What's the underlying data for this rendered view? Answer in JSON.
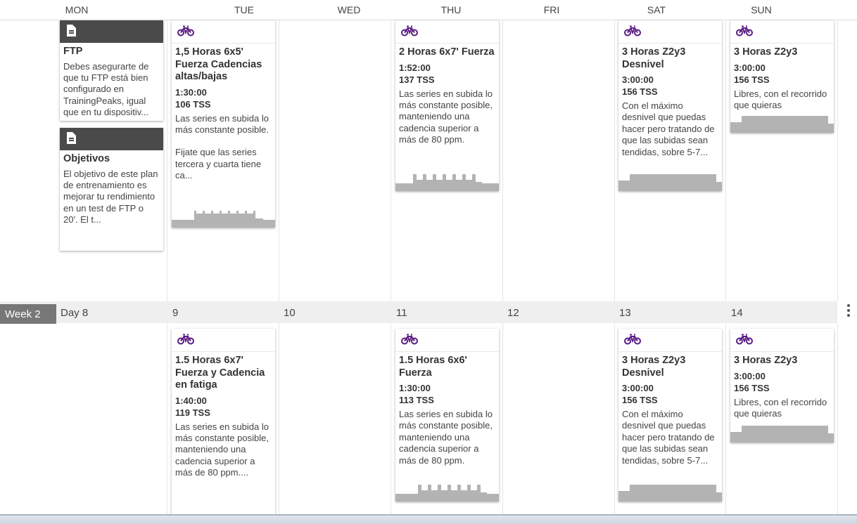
{
  "days": [
    "MON",
    "TUE",
    "WED",
    "THU",
    "FRI",
    "SAT",
    "SUN"
  ],
  "notes": [
    {
      "title": "FTP",
      "text": "Debes asegurarte de que tu FTP está bien configurado en TrainingPeaks, igual que en tu dispositiv..."
    },
    {
      "title": "Objetivos",
      "text": "El objetivo de este plan de entrenamiento es mejorar tu rendimiento en un test de FTP o 20'. El t..."
    }
  ],
  "week1": [
    {
      "title": "1,5 Horas 6x5' Fuerza Cadencias altas/bajas",
      "duration": "1:30:00",
      "tss": "106 TSS",
      "desc1": "Las series en subida lo más constante posible.",
      "desc2": "Fijate que las series tercera y cuarta tiene ca..."
    },
    {
      "title": "2 Horas 6x7' Fuerza",
      "duration": "1:52:00",
      "tss": "137 TSS",
      "desc1": "Las series en subida lo más constante posible, manteniendo una cadencia superior a más de 80 ppm."
    },
    {
      "title": "3 Horas Z2y3 Desnivel",
      "duration": "3:00:00",
      "tss": "156 TSS",
      "desc1": "Con el máximo desnivel que puedas hacer pero tratando de que las subidas sean tendidas, sobre 5-7..."
    },
    {
      "title": "3 Horas Z2y3",
      "duration": "3:00:00",
      "tss": "156 TSS",
      "desc1": "Libres, con el recorrido que quieras"
    }
  ],
  "week2": {
    "label": "Week 2",
    "day_numbers": [
      "Day 8",
      "9",
      "10",
      "11",
      "12",
      "13",
      "14"
    ],
    "workouts": [
      {
        "title": "1.5 Horas 6x7' Fuerza y Cadencia en fatiga",
        "duration": "1:40:00",
        "tss": "119 TSS",
        "desc1": "Las series en subida lo más constante posible, manteniendo una cadencia superior a más de 80 ppm...."
      },
      {
        "title": "1.5 Horas 6x6' Fuerza",
        "duration": "1:30:00",
        "tss": "113 TSS",
        "desc1": "Las series en subida lo más constante posible, manteniendo una cadencia superior a más de 80 ppm."
      },
      {
        "title": "3 Horas Z2y3 Desnivel",
        "duration": "3:00:00",
        "tss": "156 TSS",
        "desc1": "Con el máximo desnivel que puedas hacer pero tratando de que las subidas sean tendidas, sobre 5-7..."
      },
      {
        "title": "3 Horas Z2y3",
        "duration": "3:00:00",
        "tss": "156 TSS",
        "desc1": "Libres, con el recorrido que quieras"
      }
    ]
  },
  "colors": {
    "bike": "#5b1d83",
    "profile": "#b3b3b3",
    "note_header": "#4a4a4a",
    "week_label": "#777777"
  },
  "icons": {
    "workout": "bike-icon",
    "note": "document-icon",
    "more": "more-vertical-icon"
  }
}
